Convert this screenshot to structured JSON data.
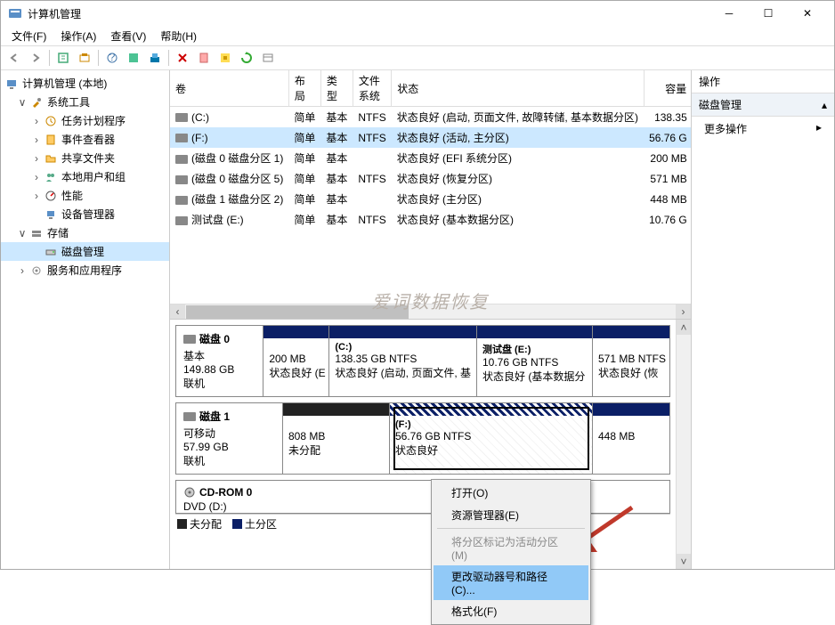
{
  "window_title": "计算机管理",
  "menu": {
    "file": "文件(F)",
    "action": "操作(A)",
    "view": "查看(V)",
    "help": "帮助(H)"
  },
  "tree": {
    "root": "计算机管理 (本地)",
    "system_tools": "系统工具",
    "task_scheduler": "任务计划程序",
    "event_viewer": "事件查看器",
    "shared_folders": "共享文件夹",
    "local_users": "本地用户和组",
    "performance": "性能",
    "device_manager": "设备管理器",
    "storage": "存储",
    "disk_management": "磁盘管理",
    "services_apps": "服务和应用程序"
  },
  "table_headers": {
    "volume": "卷",
    "layout": "布局",
    "type": "类型",
    "filesystem": "文件系统",
    "status": "状态",
    "capacity": "容量"
  },
  "watermark": "爱词数据恢复",
  "volumes": [
    {
      "name": "(C:)",
      "layout": "简单",
      "type": "基本",
      "fs": "NTFS",
      "status": "状态良好 (启动, 页面文件, 故障转储, 基本数据分区)",
      "capacity": "138.35"
    },
    {
      "name": "(F:)",
      "layout": "简单",
      "type": "基本",
      "fs": "NTFS",
      "status": "状态良好 (活动, 主分区)",
      "capacity": "56.76 G"
    },
    {
      "name": "(磁盘 0 磁盘分区 1)",
      "layout": "简单",
      "type": "基本",
      "fs": "",
      "status": "状态良好 (EFI 系统分区)",
      "capacity": "200 MB"
    },
    {
      "name": "(磁盘 0 磁盘分区 5)",
      "layout": "简单",
      "type": "基本",
      "fs": "NTFS",
      "status": "状态良好 (恢复分区)",
      "capacity": "571 MB"
    },
    {
      "name": "(磁盘 1 磁盘分区 2)",
      "layout": "简单",
      "type": "基本",
      "fs": "",
      "status": "状态良好 (主分区)",
      "capacity": "448 MB"
    },
    {
      "name": "测试盘 (E:)",
      "layout": "简单",
      "type": "基本",
      "fs": "NTFS",
      "status": "状态良好 (基本数据分区)",
      "capacity": "10.76 G"
    }
  ],
  "disk0": {
    "title": "磁盘 0",
    "type": "基本",
    "size": "149.88 GB",
    "online": "联机",
    "p1": {
      "size": "200 MB",
      "status": "状态良好 (E"
    },
    "p2": {
      "name": "(C:)",
      "size": "138.35 GB NTFS",
      "status": "状态良好 (启动, 页面文件, 基"
    },
    "p3": {
      "name": "测试盘  (E:)",
      "size": "10.76 GB NTFS",
      "status": "状态良好 (基本数据分"
    },
    "p4": {
      "size": "571 MB NTFS",
      "status": "状态良好 (恢"
    }
  },
  "disk1": {
    "title": "磁盘 1",
    "type": "可移动",
    "size": "57.99 GB",
    "online": "联机",
    "p1": {
      "size": "808 MB",
      "status": "未分配"
    },
    "p2": {
      "name": "(F:)",
      "size": "56.76 GB NTFS",
      "status": "状态良好"
    },
    "p3": {
      "size": "448 MB"
    }
  },
  "cdrom": {
    "title": "CD-ROM 0",
    "line2": "DVD (D:)",
    "line3_left": "夫分配",
    "line3_right": "土分区"
  },
  "context_menu": {
    "open": "打开(O)",
    "explorer": "资源管理器(E)",
    "mark_active": "将分区标记为活动分区(M)",
    "change_drive": "更改驱动器号和路径(C)...",
    "format": "格式化(F)"
  },
  "right_panel": {
    "header": "操作",
    "section": "磁盘管理",
    "more": "更多操作"
  }
}
